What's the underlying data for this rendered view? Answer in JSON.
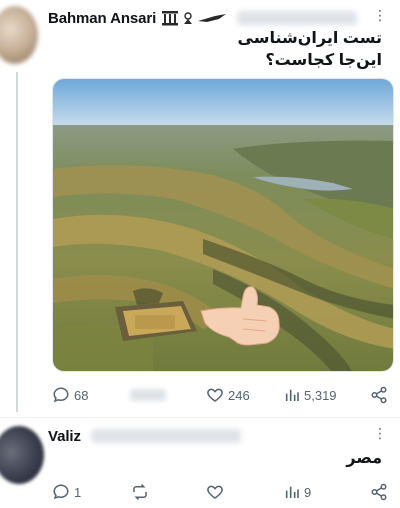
{
  "colors": {
    "text": "#0f1419",
    "muted": "#536471",
    "line": "#cfd9de"
  },
  "tweet1": {
    "author": "Bahman Ansari",
    "text_line1": "تست ایران‌شناسی",
    "text_line2": "این‌جا کجاست؟",
    "actions": {
      "replies": "68",
      "likes": "246",
      "views": "5,319"
    },
    "icons": [
      "reply-icon",
      "retweet-icon",
      "like-icon",
      "views-icon",
      "share-icon"
    ]
  },
  "tweet2": {
    "author": "Valiz",
    "text": "مصر",
    "actions": {
      "replies": "1",
      "views": "9"
    }
  }
}
